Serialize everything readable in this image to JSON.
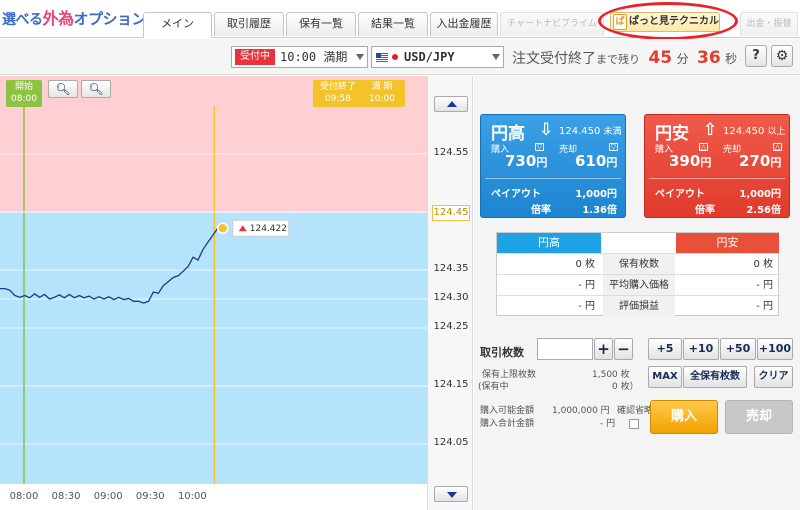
{
  "header": {
    "logo": {
      "part1": "選べる",
      "part2": "外為",
      "part3": "オプション"
    },
    "tabs": [
      "メイン",
      "取引履歴",
      "保有一覧",
      "結果一覧",
      "入出金履歴",
      "チャートナビプライム",
      "ぱっと見テクニカル",
      "出金・振替"
    ],
    "tech_badge": "ぱ"
  },
  "bar2": {
    "status": "受付中",
    "expiry": "10:00 満期",
    "pair": "USD/JPY",
    "deadline_label": "注文受付終了",
    "deadline_small": "まで残り",
    "minutes": "45",
    "min_unit": "分",
    "seconds": "36",
    "sec_unit": "秒",
    "help": "?",
    "settings_icon": "gear-icon"
  },
  "chart": {
    "start_flag": {
      "label": "開始",
      "time": "08:00"
    },
    "end_flag": {
      "label": "受付終了",
      "time": "09:58",
      "label2": "満 期",
      "time2": "10:00"
    },
    "zoom_out": "−",
    "zoom_in": "+",
    "current_marker": "124.422",
    "axis_labels": [
      "124.55",
      "124.45",
      "124.35",
      "124.30",
      "124.25",
      "124.15",
      "124.05"
    ],
    "x_labels": [
      "08:00",
      "08:30",
      "09:00",
      "09:30",
      "10:00"
    ],
    "colors": {
      "upper": "#ffcfd3",
      "lower": "#b5e3fb",
      "start_line": "#8cc43f",
      "end_line": "#f4c32a",
      "price": "#1a3a8a"
    }
  },
  "chart_data": {
    "type": "line",
    "series": [
      {
        "values": [
          [
            0,
            124.318
          ],
          [
            5,
            124.318
          ],
          [
            10,
            124.315
          ],
          [
            15,
            124.306
          ],
          [
            20,
            124.303
          ],
          [
            25,
            124.306
          ],
          [
            30,
            124.302
          ],
          [
            35,
            124.309
          ],
          [
            40,
            124.303
          ],
          [
            45,
            124.308
          ],
          [
            50,
            124.3
          ],
          [
            55,
            124.303
          ],
          [
            60,
            124.307
          ],
          [
            65,
            124.302
          ],
          [
            70,
            124.308
          ],
          [
            75,
            124.302
          ],
          [
            80,
            124.306
          ],
          [
            85,
            124.302
          ],
          [
            90,
            124.305
          ],
          [
            95,
            124.3
          ],
          [
            100,
            124.304
          ],
          [
            105,
            124.3
          ],
          [
            110,
            124.304
          ],
          [
            115,
            124.299
          ],
          [
            120,
            124.303
          ],
          [
            125,
            124.299
          ],
          [
            130,
            124.301
          ],
          [
            135,
            124.296
          ],
          [
            140,
            124.296
          ],
          [
            145,
            124.293
          ],
          [
            150,
            124.296
          ],
          [
            155,
            124.312
          ],
          [
            160,
            124.31
          ],
          [
            165,
            124.323
          ],
          [
            170,
            124.33
          ],
          [
            175,
            124.337
          ],
          [
            180,
            124.34
          ],
          [
            185,
            124.348
          ],
          [
            190,
            124.356
          ],
          [
            195,
            124.372
          ],
          [
            200,
            124.367
          ],
          [
            205,
            124.385
          ],
          [
            210,
            124.398
          ],
          [
            215,
            124.41
          ],
          [
            220,
            124.422
          ],
          [
            225,
            124.422
          ]
        ]
      }
    ],
    "x_ticks": [
      "08:00",
      "08:30",
      "09:00",
      "09:30",
      "10:00"
    ],
    "y_ticks": [
      124.55,
      124.45,
      124.35,
      124.3,
      124.25,
      124.15,
      124.05
    ],
    "strike": 124.45,
    "grid": true
  },
  "panel": {
    "high": {
      "title": "円高",
      "arrow": "⇩",
      "strike": "124.450",
      "strike_note": "未満",
      "buy_lbl": "購入",
      "sell_lbl": "売却",
      "buy_price": "730",
      "sell_price": "610",
      "yen": "円",
      "payout_lbl": "ペイアウト",
      "payout": "1,000円",
      "ratio_lbl": "倍率",
      "ratio": "1.36倍"
    },
    "low": {
      "title": "円安",
      "arrow": "⇧",
      "strike": "124.450",
      "strike_note": "以上",
      "buy_lbl": "購入",
      "sell_lbl": "売却",
      "buy_price": "390",
      "sell_price": "270",
      "yen": "円",
      "payout_lbl": "ペイアウト",
      "payout": "1,000円",
      "ratio_lbl": "倍率",
      "ratio": "2.56倍"
    },
    "table": {
      "head_high": "円高",
      "head_low": "円安",
      "rows": [
        {
          "label": "保有枚数",
          "high": "0 枚",
          "low": "0 枚"
        },
        {
          "label": "平均購入価格",
          "high": "- 円",
          "low": "- 円"
        },
        {
          "label": "評価損益",
          "high": "- 円",
          "low": "- 円"
        }
      ]
    },
    "qty_label": "取引枚数",
    "plus": "+",
    "minus": "−",
    "step_buttons": [
      "+5",
      "+10",
      "+50",
      "+100"
    ],
    "max_btn": "MAX",
    "all_btn": "全保有枚数",
    "clear_btn": "クリア",
    "limit_lbl": "保有上限枚数",
    "limit_val": "1,500 枚",
    "holding_lbl": "(保有中",
    "holding_val": "0 枚）",
    "avail_lbl": "購入可能金額",
    "avail_val": "1,000,000 円",
    "total_lbl": "購入合計金額",
    "total_val": "- 円",
    "confirm_lbl": "確認省略",
    "buy_btn": "購入",
    "sell_btn": "売却"
  }
}
